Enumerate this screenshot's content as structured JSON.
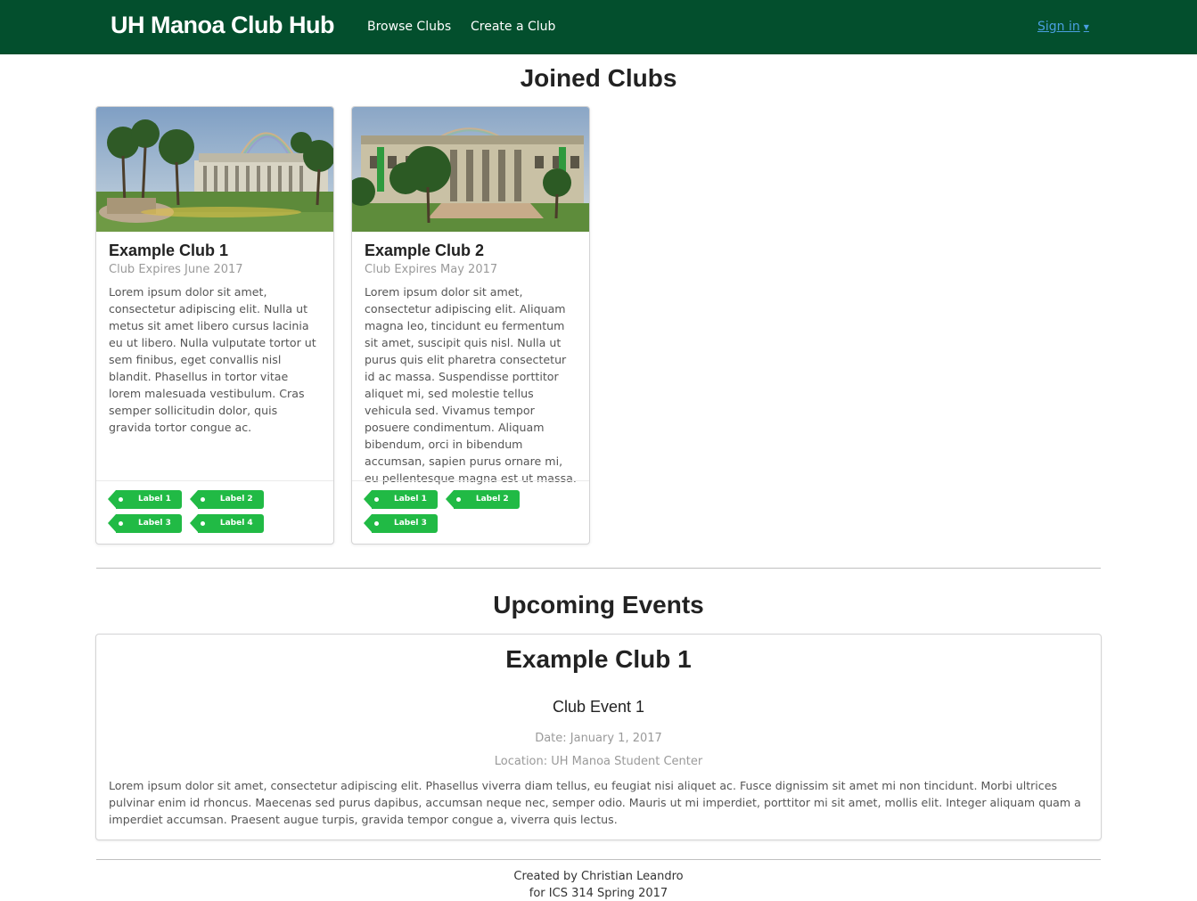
{
  "navbar": {
    "brand": "UH Manoa Club Hub",
    "links": [
      "Browse Clubs",
      "Create a Club"
    ],
    "signin": "Sign in",
    "signin_caret": "▼",
    "bg_color": "#034f2d"
  },
  "joined": {
    "title": "Joined Clubs",
    "clubs": [
      {
        "name": "Example Club 1",
        "meta": "Club Expires June 2017",
        "description": "Lorem ipsum dolor sit amet, consectetur adipiscing elit. Nulla ut metus sit amet libero cursus lacinia eu ut libero. Nulla vulputate tortor ut sem finibus, eget convallis nisl blandit. Phasellus in tortor vitae lorem malesuada vestibulum. Cras semper sollicitudin dolor, quis gravida tortor congue ac.",
        "labels": [
          "Label 1",
          "Label 2",
          "Label 3",
          "Label 4"
        ]
      },
      {
        "name": "Example Club 2",
        "meta": "Club Expires May 2017",
        "description": "Lorem ipsum dolor sit amet, consectetur adipiscing elit. Aliquam magna leo, tincidunt eu fermentum sit amet, suscipit quis nisl. Nulla ut purus quis elit pharetra consectetur id ac massa. Suspendisse porttitor aliquet mi, sed molestie tellus vehicula sed. Vivamus tempor posuere condimentum. Aliquam bibendum, orci in bibendum accumsan, sapien purus ornare mi, eu pellentesque magna est ut massa.",
        "labels": [
          "Label 1",
          "Label 2",
          "Label 3"
        ]
      }
    ],
    "label_color": "#21ba45"
  },
  "events": {
    "title": "Upcoming Events",
    "club": "Example Club 1",
    "event_name": "Club Event 1",
    "date": "Date: January 1, 2017",
    "location": "Location: UH Manoa Student Center",
    "description": "Lorem ipsum dolor sit amet, consectetur adipiscing elit. Phasellus viverra diam tellus, eu feugiat nisi aliquet ac. Fusce dignissim sit amet mi non tincidunt. Morbi ultrices pulvinar enim id rhoncus. Maecenas sed purus dapibus, accumsan neque nec, semper odio. Mauris ut mi imperdiet, porttitor mi sit amet, mollis elit. Integer aliquam quam a imperdiet accumsan. Praesent augue turpis, gravida tempor congue a, viverra quis lectus."
  },
  "footer": {
    "line1": "Created by Christian Leandro",
    "line2": "for ICS 314 Spring 2017"
  }
}
